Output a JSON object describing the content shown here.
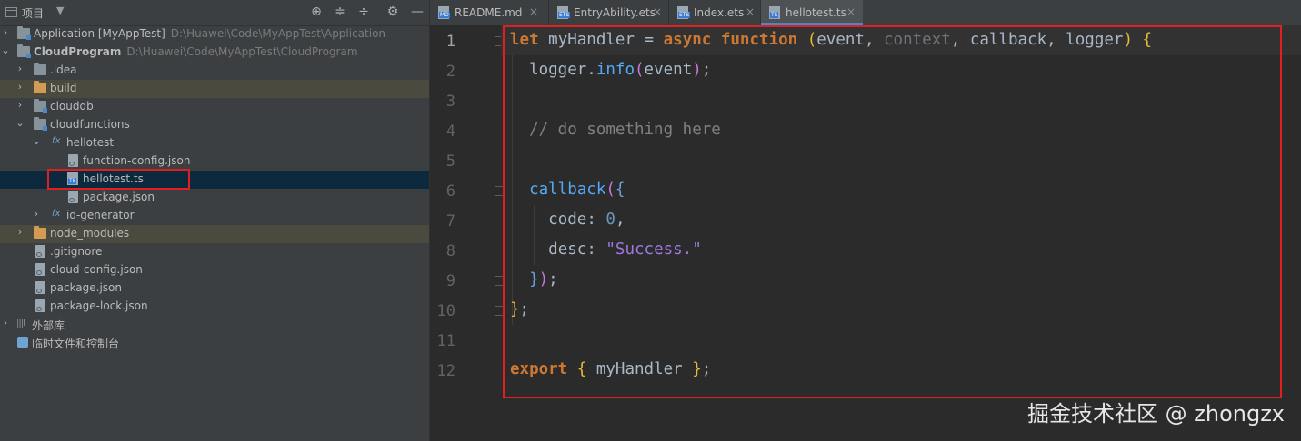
{
  "project_panel": {
    "title": "项目",
    "tools": [
      "crosshair-icon",
      "expand-all-icon",
      "collapse-all-icon",
      "gear-icon",
      "minimize-icon"
    ],
    "tree": [
      {
        "label": "Application [MyAppTest]",
        "path": "D:\\Huawei\\Code\\MyAppTest\\Application"
      },
      {
        "label": "CloudProgram",
        "path": "D:\\Huawei\\Code\\MyAppTest\\CloudProgram"
      },
      {
        "label": ".idea"
      },
      {
        "label": "build"
      },
      {
        "label": "clouddb"
      },
      {
        "label": "cloudfunctions"
      },
      {
        "label": "hellotest"
      },
      {
        "label": "function-config.json"
      },
      {
        "label": "hellotest.ts"
      },
      {
        "label": "package.json"
      },
      {
        "label": "id-generator"
      },
      {
        "label": "node_modules"
      },
      {
        "label": ".gitignore"
      },
      {
        "label": "cloud-config.json"
      },
      {
        "label": "package.json"
      },
      {
        "label": "package-lock.json"
      },
      {
        "label": "外部库"
      },
      {
        "label": "临时文件和控制台"
      }
    ]
  },
  "editor": {
    "tabs": [
      {
        "label": "README.md"
      },
      {
        "label": "EntryAbility.ets"
      },
      {
        "label": "Index.ets"
      },
      {
        "label": "hellotest.ts"
      }
    ],
    "line_numbers": [
      "1",
      "2",
      "3",
      "4",
      "5",
      "6",
      "7",
      "8",
      "9",
      "10",
      "11",
      "12"
    ],
    "code": {
      "l1": [
        "let",
        "myHandler",
        "=",
        "async",
        "function",
        "(",
        "event",
        ", ",
        "context",
        ", ",
        "callback",
        ", ",
        "logger",
        ")",
        "{"
      ],
      "l2": [
        "logger",
        ".",
        "info",
        "(",
        "event",
        ")",
        ";"
      ],
      "l4": "// do something here",
      "l6": [
        "callback",
        "(",
        "{"
      ],
      "l7": [
        "code",
        ": ",
        "0",
        ","
      ],
      "l8": [
        "desc",
        ": ",
        "\"Success.\""
      ],
      "l9": [
        "}",
        ")",
        ";"
      ],
      "l10": [
        "}",
        ";"
      ],
      "l12": [
        "export",
        "{",
        "myHandler",
        "}",
        ";"
      ]
    }
  },
  "watermark": "掘金技术社区 @ zhongzx"
}
